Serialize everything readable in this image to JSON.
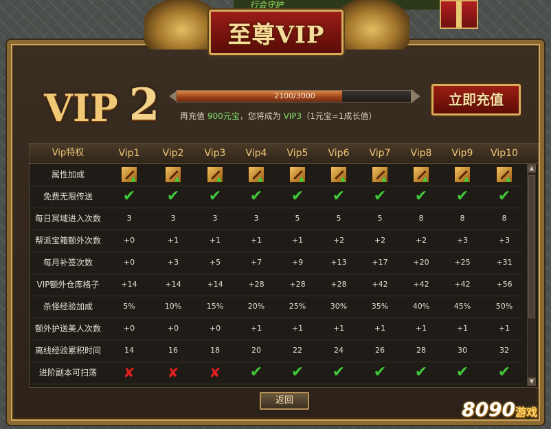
{
  "top_banner": {
    "text": "行会守护"
  },
  "window": {
    "title": "至尊VIP"
  },
  "vip": {
    "word": "VIP",
    "level": "2",
    "progress_text": "2100/3000",
    "progress_fraction": 0.7,
    "hint_prefix": "再充值 ",
    "hint_amount": "900元宝",
    "hint_middle": "，您将成为 ",
    "hint_target": "VIP3",
    "hint_suffix": "（1元宝=1成长值）",
    "recharge_label": "立即充值"
  },
  "table": {
    "headers": [
      "Vip特权",
      "Vip1",
      "Vip2",
      "Vip3",
      "Vip4",
      "Vip5",
      "Vip6",
      "Vip7",
      "Vip8",
      "Vip9",
      "Vip10"
    ],
    "rows": [
      {
        "label": "属性加成",
        "kind": "icon",
        "values": [
          "buff",
          "buff",
          "buff",
          "buff",
          "buff",
          "buff",
          "buff",
          "buff",
          "buff",
          "buff"
        ]
      },
      {
        "label": "免费无限传送",
        "kind": "mark",
        "values": [
          "check",
          "check",
          "check",
          "check",
          "check",
          "check",
          "check",
          "check",
          "check",
          "check"
        ]
      },
      {
        "label": "每日冥域进入次数",
        "kind": "text",
        "values": [
          "3",
          "3",
          "3",
          "3",
          "5",
          "5",
          "5",
          "8",
          "8",
          "8"
        ]
      },
      {
        "label": "帮派宝箱额外次数",
        "kind": "text",
        "values": [
          "+0",
          "+1",
          "+1",
          "+1",
          "+1",
          "+2",
          "+2",
          "+2",
          "+3",
          "+3"
        ]
      },
      {
        "label": "每月补签次数",
        "kind": "text",
        "values": [
          "+0",
          "+3",
          "+5",
          "+7",
          "+9",
          "+13",
          "+17",
          "+20",
          "+25",
          "+31"
        ]
      },
      {
        "label": "VIP额外仓库格子",
        "kind": "text",
        "values": [
          "+14",
          "+14",
          "+14",
          "+28",
          "+28",
          "+28",
          "+42",
          "+42",
          "+42",
          "+56"
        ]
      },
      {
        "label": "杀怪经验加成",
        "kind": "text",
        "values": [
          "5%",
          "10%",
          "15%",
          "20%",
          "25%",
          "30%",
          "35%",
          "40%",
          "45%",
          "50%"
        ]
      },
      {
        "label": "额外护送美人次数",
        "kind": "text",
        "values": [
          "+0",
          "+0",
          "+0",
          "+1",
          "+1",
          "+1",
          "+1",
          "+1",
          "+1",
          "+1"
        ]
      },
      {
        "label": "离线经验累积时间",
        "kind": "text",
        "values": [
          "14",
          "16",
          "18",
          "20",
          "22",
          "24",
          "26",
          "28",
          "30",
          "32"
        ]
      },
      {
        "label": "进阶副本可扫荡",
        "kind": "mark",
        "values": [
          "cross",
          "cross",
          "cross",
          "check",
          "check",
          "check",
          "check",
          "check",
          "check",
          "check"
        ]
      }
    ]
  },
  "icons": {
    "check": "✔",
    "cross": "✘",
    "scroll_up": "▲",
    "scroll_down": "▼"
  },
  "back_label": "返回",
  "watermark": {
    "num": "8090",
    "cn": "游戏"
  }
}
